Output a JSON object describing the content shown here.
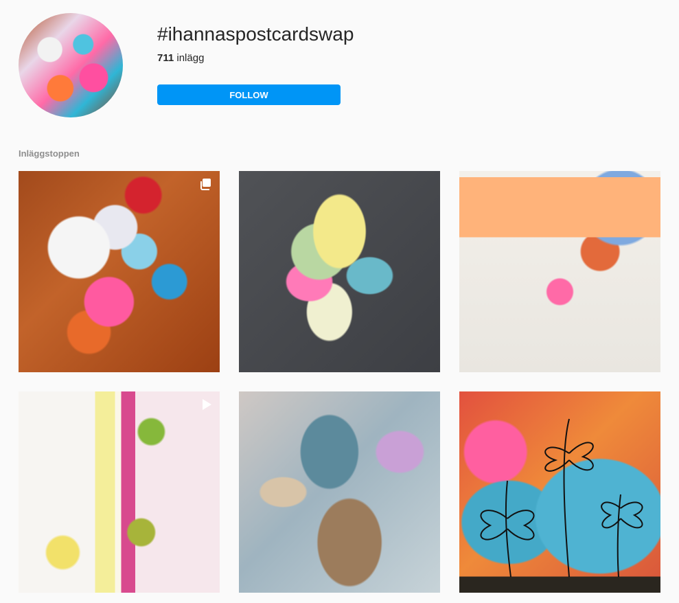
{
  "header": {
    "hashtag": "#ihannaspostcardswap",
    "post_count": "711",
    "post_label": "inlägg",
    "follow_label": "FOLLOW"
  },
  "top_posts": {
    "label": "Inläggstoppen",
    "items": [
      {
        "icon": "multiple-posts-icon"
      },
      {
        "icon": ""
      },
      {
        "icon": ""
      },
      {
        "icon": "play-video-icon"
      },
      {
        "icon": ""
      },
      {
        "icon": ""
      }
    ]
  },
  "colors": {
    "accent": "#0095f6",
    "text": "#262626",
    "muted": "#8e8e8e",
    "background": "#fafafa"
  }
}
